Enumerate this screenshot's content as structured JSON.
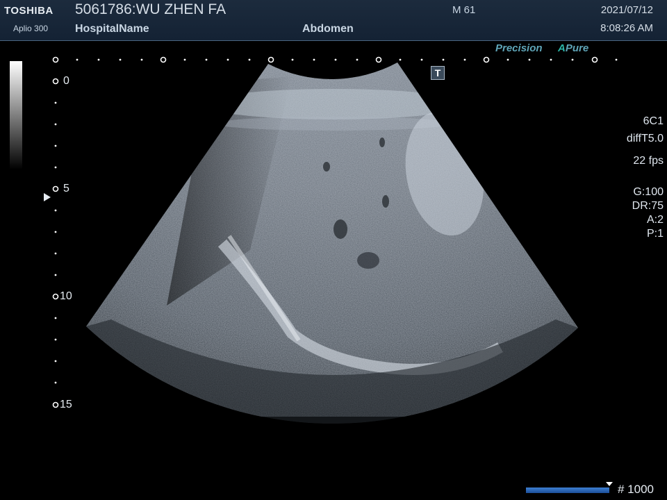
{
  "header": {
    "brand": "TOSHIBA",
    "model": "Aplio 300",
    "patient": "5061786:WU ZHEN FA",
    "hospital": "HospitalName",
    "exam": "Abdomen",
    "age": "M 61",
    "date": "2021/07/12",
    "time": "8:08:26 AM"
  },
  "tags": {
    "precision": "Precision",
    "apure_a": "A",
    "apure_rest": "Pure"
  },
  "params": {
    "probe": "6C1",
    "mode": "diffT5.0",
    "fps": "22 fps",
    "gain": "G:100",
    "dr": "DR:75",
    "a": "A:2",
    "p": "P:1"
  },
  "depth_scale": {
    "labels": [
      "0",
      "5",
      "10",
      "15"
    ],
    "focus_marker_depth": 5.5
  },
  "t_marker": "T",
  "frame": {
    "count_label": "# 1000",
    "position": 1.0
  },
  "colors": {
    "header_bg": "#1c2b3d",
    "accent_teal": "#2bb5a8",
    "frame_bar": "#3d7fd1"
  },
  "icons": {
    "focus": "triangle-right-icon",
    "t": "t-marker-icon"
  }
}
